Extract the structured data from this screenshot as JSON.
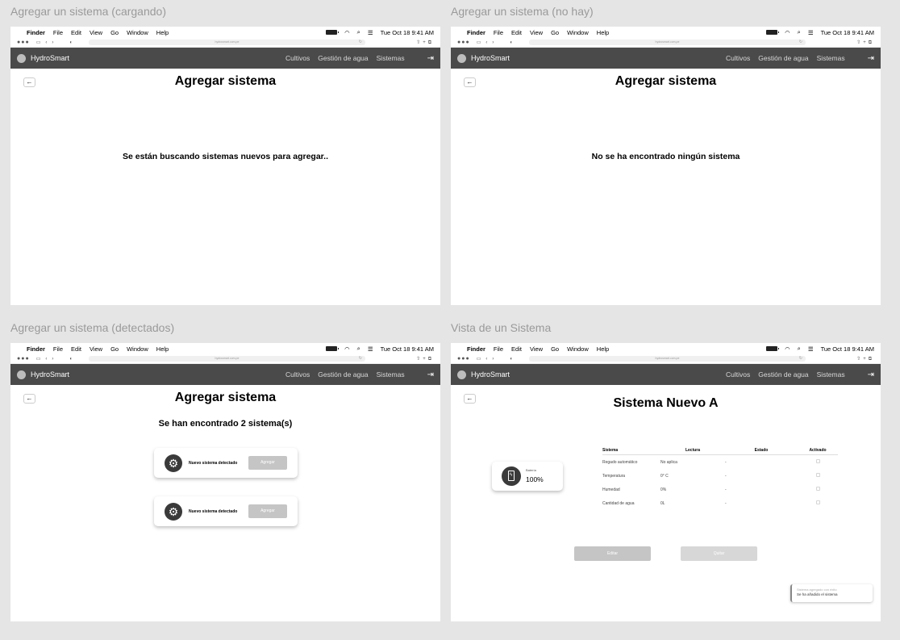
{
  "chrome": {
    "menu": [
      "Finder",
      "File",
      "Edit",
      "View",
      "Go",
      "Window",
      "Help"
    ],
    "clock": "Tue Oct 18  9:41 AM",
    "url": "hydrosmart.com.pe",
    "brand": "HydroSmart",
    "nav": [
      "Cultivos",
      "Gestión de agua",
      "Sistemas"
    ]
  },
  "panels": {
    "loading": {
      "title": "Agregar un sistema (cargando)",
      "heading": "Agregar sistema",
      "message": "Se están buscando sistemas nuevos para agregar.."
    },
    "empty": {
      "title": "Agregar un sistema (no hay)",
      "heading": "Agregar sistema",
      "message": "No se ha encontrado ningún sistema"
    },
    "detected": {
      "title": "Agregar un sistema (detectados)",
      "heading": "Agregar sistema",
      "message": "Se han encontrado 2 sistema(s)",
      "cards": [
        {
          "label": "Nuevo sistema detectado",
          "button": "Agregar"
        },
        {
          "label": "Nuevo sistema detectado",
          "button": "Agregar"
        }
      ]
    },
    "view": {
      "title": "Vista de un Sistema",
      "heading": "Sistema Nuevo A",
      "battery": {
        "label": "Batería",
        "value": "100%"
      },
      "table": {
        "headers": [
          "Sistema",
          "Lectura",
          "Estado",
          "Activado"
        ],
        "rows": [
          [
            "Regado automático",
            "No aplica",
            "-"
          ],
          [
            "Temperatura",
            "0° C",
            "-"
          ],
          [
            "Humedad",
            "0%",
            "-"
          ],
          [
            "Cantidad de agua",
            "0L",
            "-"
          ]
        ]
      },
      "edit_button": "Editar",
      "remove_button": "Quitar",
      "toast": {
        "title": "Sistema agregado con éxito",
        "body": "Se ha añadido el sistema"
      }
    }
  }
}
